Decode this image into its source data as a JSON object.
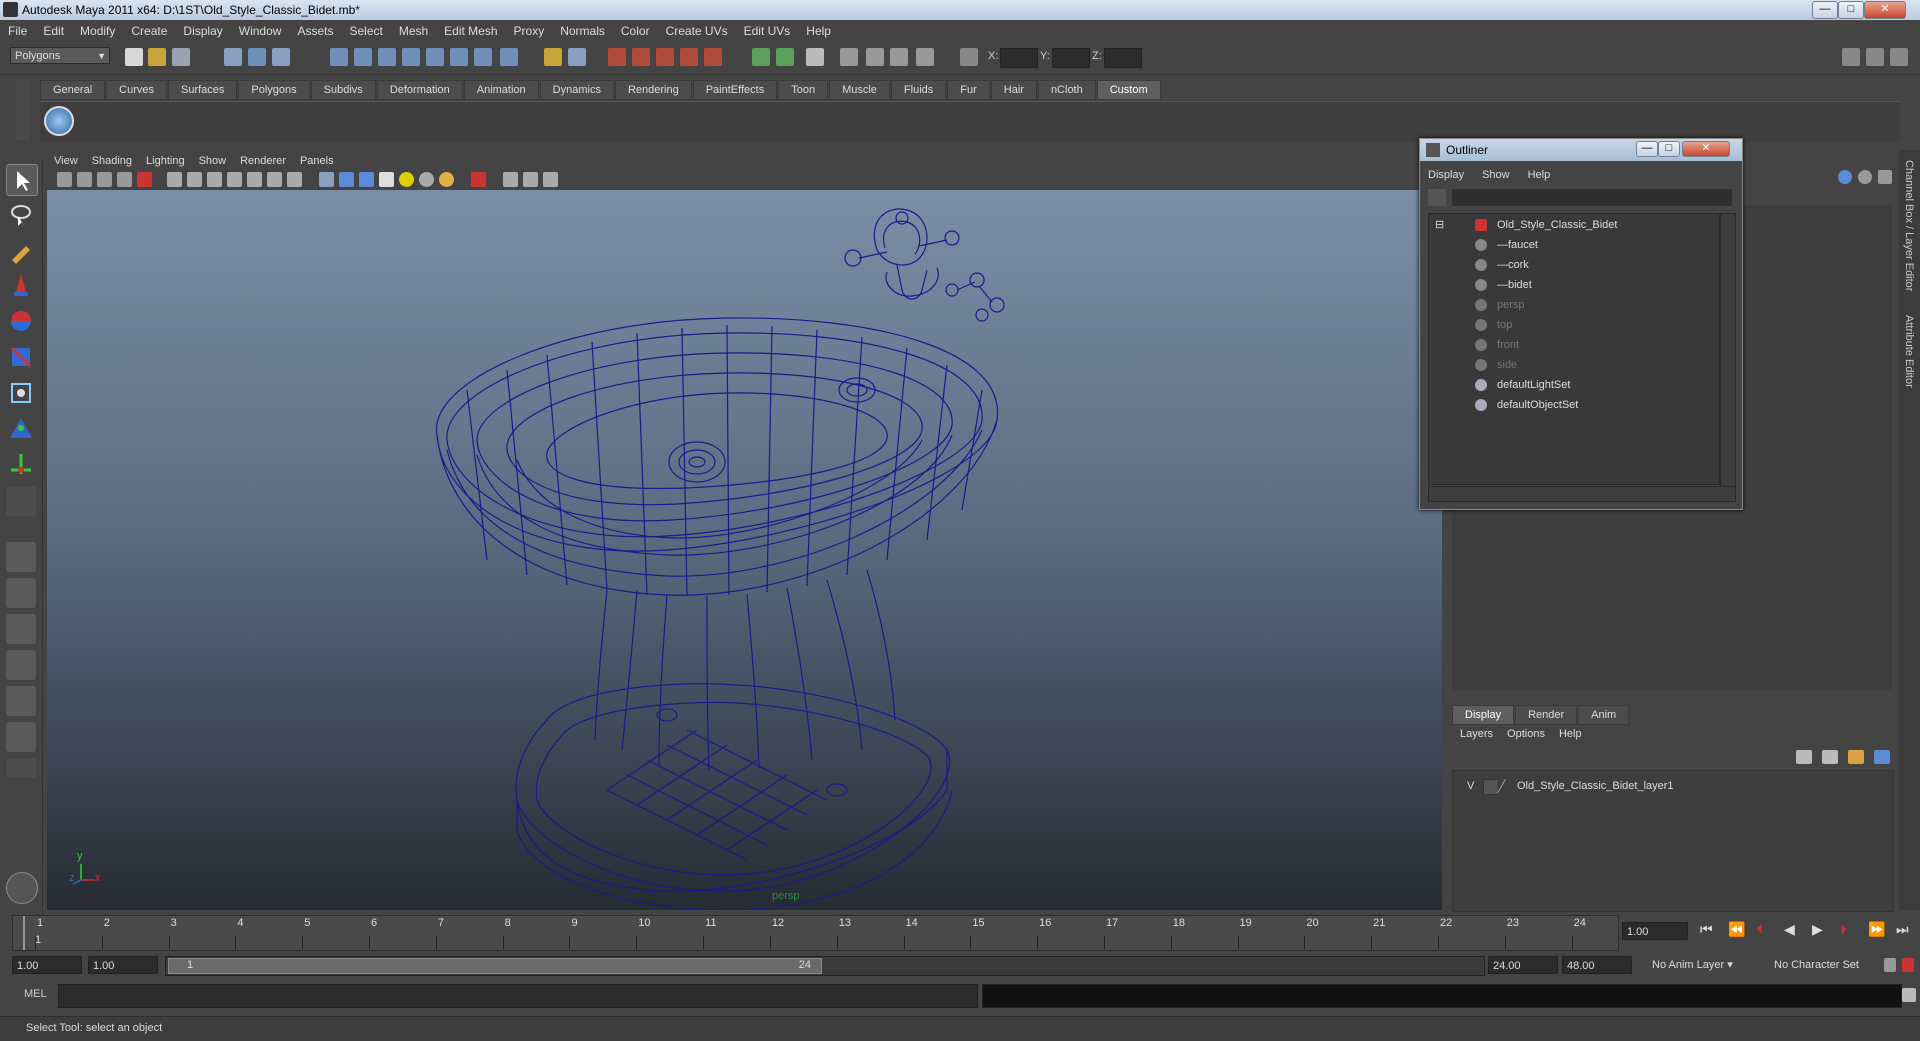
{
  "window": {
    "title": "Autodesk Maya 2011 x64: D:\\1ST\\Old_Style_Classic_Bidet.mb*",
    "minimize": "—",
    "maximize": "□",
    "close": "✕"
  },
  "menubar": [
    "File",
    "Edit",
    "Modify",
    "Create",
    "Display",
    "Window",
    "Assets",
    "Select",
    "Mesh",
    "Edit Mesh",
    "Proxy",
    "Normals",
    "Color",
    "Create UVs",
    "Edit UVs",
    "Help"
  ],
  "statusline": {
    "mode": "Polygons",
    "x_label": "X:",
    "y_label": "Y:",
    "z_label": "Z:"
  },
  "shelf": {
    "tabs": [
      "General",
      "Curves",
      "Surfaces",
      "Polygons",
      "Subdivs",
      "Deformation",
      "Animation",
      "Dynamics",
      "Rendering",
      "PaintEffects",
      "Toon",
      "Muscle",
      "Fluids",
      "Fur",
      "Hair",
      "nCloth",
      "Custom"
    ],
    "active": "Custom"
  },
  "viewport": {
    "menu": [
      "View",
      "Shading",
      "Lighting",
      "Show",
      "Renderer",
      "Panels"
    ],
    "camera": "persp",
    "axis_y": "y",
    "axis_x": "x",
    "axis_z": "z",
    "wire_color": "#1a1a8c"
  },
  "outliner": {
    "title": "Outliner",
    "menu": [
      "Display",
      "Show",
      "Help"
    ],
    "items": [
      {
        "label": "Old_Style_Classic_Bidet",
        "dim": false
      },
      {
        "label": "faucet",
        "dim": false
      },
      {
        "label": "cork",
        "dim": false
      },
      {
        "label": "bidet",
        "dim": false
      },
      {
        "label": "persp",
        "dim": true
      },
      {
        "label": "top",
        "dim": true
      },
      {
        "label": "front",
        "dim": true
      },
      {
        "label": "side",
        "dim": true
      },
      {
        "label": "defaultLightSet",
        "dim": false
      },
      {
        "label": "defaultObjectSet",
        "dim": false
      }
    ]
  },
  "sidetabs": {
    "channel": "Channel Box / Layer Editor",
    "attribute": "Attribute Editor"
  },
  "layers": {
    "tabs": [
      "Display",
      "Render",
      "Anim"
    ],
    "active": "Display",
    "menu": [
      "Layers",
      "Options",
      "Help"
    ],
    "visibility": "V",
    "layer_name": "Old_Style_Classic_Bidet_layer1"
  },
  "timeline": {
    "ticks": [
      "1",
      "2",
      "3",
      "4",
      "5",
      "6",
      "7",
      "8",
      "9",
      "10",
      "11",
      "12",
      "13",
      "14",
      "15",
      "16",
      "17",
      "18",
      "19",
      "20",
      "21",
      "22",
      "23",
      "24"
    ],
    "current_frame": "1",
    "time_field": "1.00"
  },
  "range": {
    "start": "1.00",
    "start2": "1.00",
    "thumb_start": "1",
    "thumb_end": "24",
    "end": "24.00",
    "end2": "48.00",
    "anim_layer": "No Anim Layer",
    "char_set": "No Character Set"
  },
  "command": {
    "label": "MEL"
  },
  "help": {
    "text": "Select Tool: select an object"
  }
}
